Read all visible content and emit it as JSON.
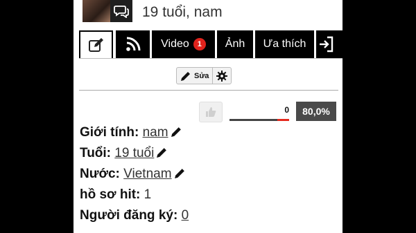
{
  "header": {
    "title": "19 tuổi, nam"
  },
  "tabs": [
    {
      "id": "edit",
      "icon": "edit-icon"
    },
    {
      "id": "feed",
      "icon": "rss-icon"
    },
    {
      "id": "video",
      "label": "Video",
      "badge": "1"
    },
    {
      "id": "photos",
      "label": "Ảnh"
    },
    {
      "id": "favorites",
      "label": "Ưa thích"
    },
    {
      "id": "more",
      "icon": "sign-in-icon"
    }
  ],
  "edit": {
    "label": "Sửa"
  },
  "rating": {
    "likes": "0",
    "percent_label": "80,0%",
    "percent": 80
  },
  "info": [
    {
      "label": "Giới tính:",
      "value": "nam",
      "editable": true
    },
    {
      "label": "Tuổi:",
      "value": "19 tuổi",
      "editable": true
    },
    {
      "label": "Nước:",
      "value": "Vietnam",
      "editable": true
    },
    {
      "label": "hồ sơ hit:",
      "value": "1",
      "editable": false
    },
    {
      "label": "Người đăng ký:",
      "value": "0",
      "editable": false
    }
  ],
  "colors": {
    "accent_red": "#e52a1e",
    "badge": "#e0231c",
    "tab_bg": "#000000",
    "rating_bg": "#4a4a4a"
  }
}
